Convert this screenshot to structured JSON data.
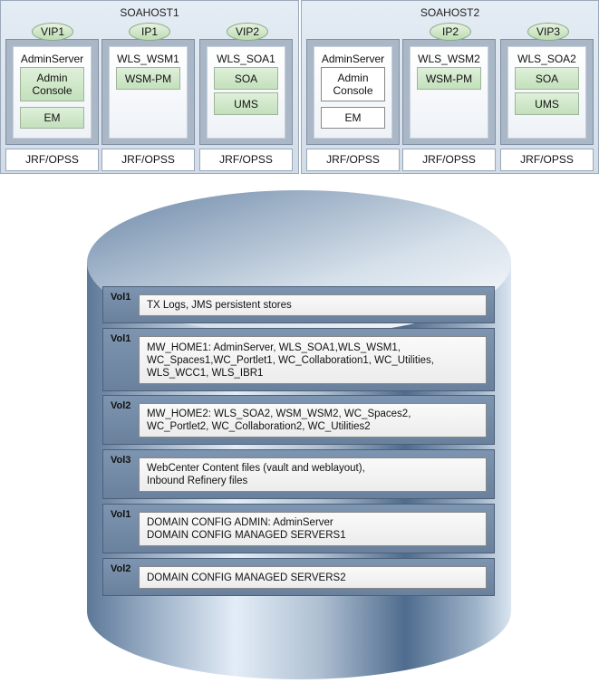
{
  "hosts": [
    {
      "title": "SOAHOST1",
      "ips": [
        "VIP1",
        "IP1",
        "VIP2"
      ],
      "servers": [
        {
          "name": "AdminServer",
          "components": [
            "Admin Console",
            "EM"
          ]
        },
        {
          "name": "WLS_WSM1",
          "components": [
            "WSM-PM"
          ]
        },
        {
          "name": "WLS_SOA1",
          "components": [
            "SOA",
            "UMS"
          ]
        }
      ],
      "jrf": [
        "JRF/OPSS",
        "JRF/OPSS",
        "JRF/OPSS"
      ]
    },
    {
      "title": "SOAHOST2",
      "ips": [
        "IP2",
        "VIP3"
      ],
      "servers": [
        {
          "name": "AdminServer",
          "components": [
            "Admin Console",
            "EM"
          ]
        },
        {
          "name": "WLS_WSM2",
          "components": [
            "WSM-PM"
          ]
        },
        {
          "name": "WLS_SOA2",
          "components": [
            "SOA",
            "UMS"
          ]
        }
      ],
      "jrf": [
        "JRF/OPSS",
        "JRF/OPSS",
        "JRF/OPSS"
      ]
    }
  ],
  "storage": {
    "volumes": [
      {
        "label": "Vol1",
        "lines": [
          "TX Logs, JMS persistent stores"
        ]
      },
      {
        "label": "Vol1",
        "lines": [
          "MW_HOME1: AdminServer, WLS_SOA1,WLS_WSM1,",
          "WC_Spaces1,WC_Portlet1, WC_Collaboration1, WC_Utilities,",
          "WLS_WCC1, WLS_IBR1"
        ]
      },
      {
        "label": "Vol2",
        "lines": [
          "MW_HOME2: WLS_SOA2, WSM_WSM2, WC_Spaces2,",
          "WC_Portlet2, WC_Collaboration2, WC_Utilities2"
        ]
      },
      {
        "label": "Vol3",
        "lines": [
          "WebCenter Content files (vault and weblayout),",
          "Inbound Refinery files"
        ]
      },
      {
        "label": "Vol1",
        "lines": [
          "DOMAIN CONFIG ADMIN: AdminServer",
          "DOMAIN CONFIG MANAGED SERVERS1"
        ]
      },
      {
        "label": "Vol2",
        "lines": [
          "DOMAIN CONFIG MANAGED SERVERS2"
        ]
      }
    ]
  }
}
